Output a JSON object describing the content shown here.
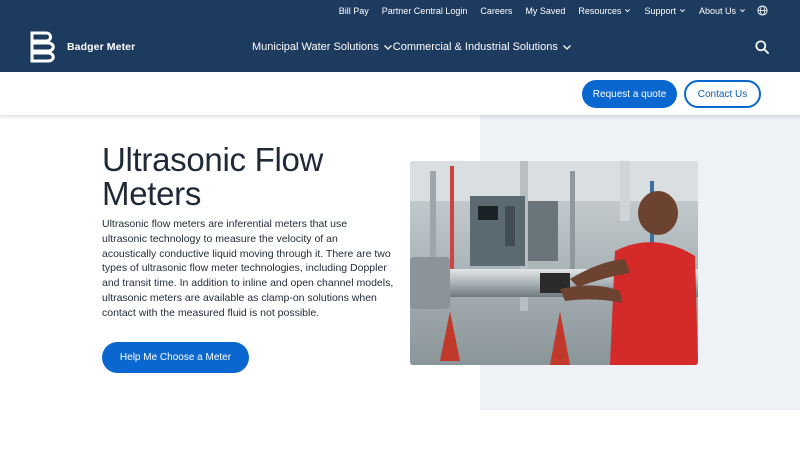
{
  "header": {
    "brand": "Badger Meter",
    "utility_nav": [
      {
        "label": "Bill Pay",
        "dropdown": false
      },
      {
        "label": "Partner Central Login",
        "dropdown": false
      },
      {
        "label": "Careers",
        "dropdown": false
      },
      {
        "label": "My Saved",
        "dropdown": false
      },
      {
        "label": "Resources",
        "dropdown": true
      },
      {
        "label": "Support",
        "dropdown": true
      },
      {
        "label": "About Us",
        "dropdown": true
      }
    ],
    "main_nav": [
      {
        "label": "Municipal Water Solutions"
      },
      {
        "label": "Commercial & Industrial Solutions"
      }
    ],
    "icons": {
      "search": "search-icon",
      "globe": "globe-icon",
      "logo": "badger-meter-logo"
    }
  },
  "subbar": {
    "quote_label": "Request a quote",
    "contact_label": "Contact Us"
  },
  "hero": {
    "title": "Ultrasonic Flow Meters",
    "description": "Ultrasonic flow meters are inferential meters that use ultrasonic technology to measure the velocity of an acoustically conductive liquid moving through it. There are two types of ultrasonic flow meter technologies, including Doppler and transit time. In addition to inline and open channel models, ultrasonic meters are available as clamp-on solutions when contact with the measured fluid is not possible.",
    "cta_label": "Help Me Choose a Meter"
  },
  "colors": {
    "header_bg": "#1d3a5f",
    "accent": "#0b67d0",
    "panel_bg": "#eef1f6",
    "text": "#1f2937"
  }
}
